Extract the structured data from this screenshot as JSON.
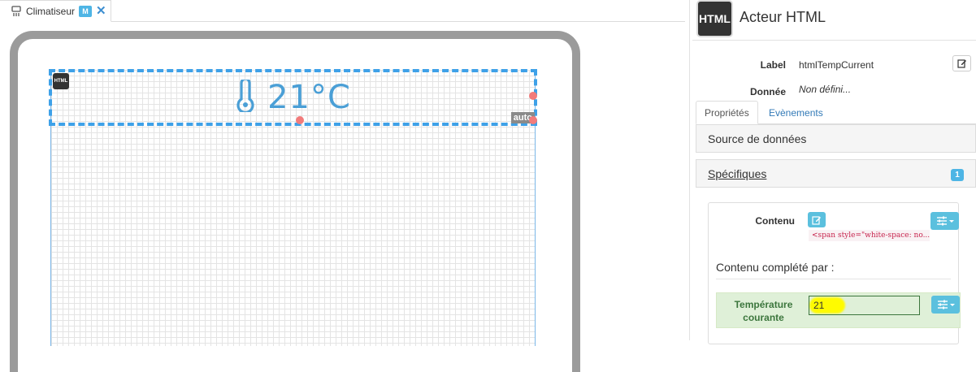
{
  "editor": {
    "tab_label": "Climatiseur",
    "tab_badge": "M",
    "widget": {
      "value_text": "21°C",
      "html_badge": "HTML",
      "auto_badge": "auto"
    }
  },
  "panel": {
    "header_icon_text": "HTML",
    "title": "Acteur HTML",
    "label_caption": "Label",
    "label_value": "htmlTempCurrent",
    "data_caption": "Donnée",
    "data_value": "Non défini...",
    "tabs": [
      "Propriétés",
      "Evènements"
    ],
    "sections": {
      "source": "Source de données",
      "specific": "Spécifiques",
      "specific_count": "1"
    },
    "content_caption": "Contenu",
    "content_code": "<span style=\"white-space: no...",
    "completed_by": "Contenu complété par :",
    "temp_label": "Température courante",
    "temp_value": "21"
  },
  "colors": {
    "accent": "#4eb5e5",
    "widget_border": "#3ea1e8",
    "temperature_text": "#4a9fd6",
    "success_bg": "#dff0d8",
    "success_text": "#3c763d",
    "handle": "#f27b7b"
  }
}
